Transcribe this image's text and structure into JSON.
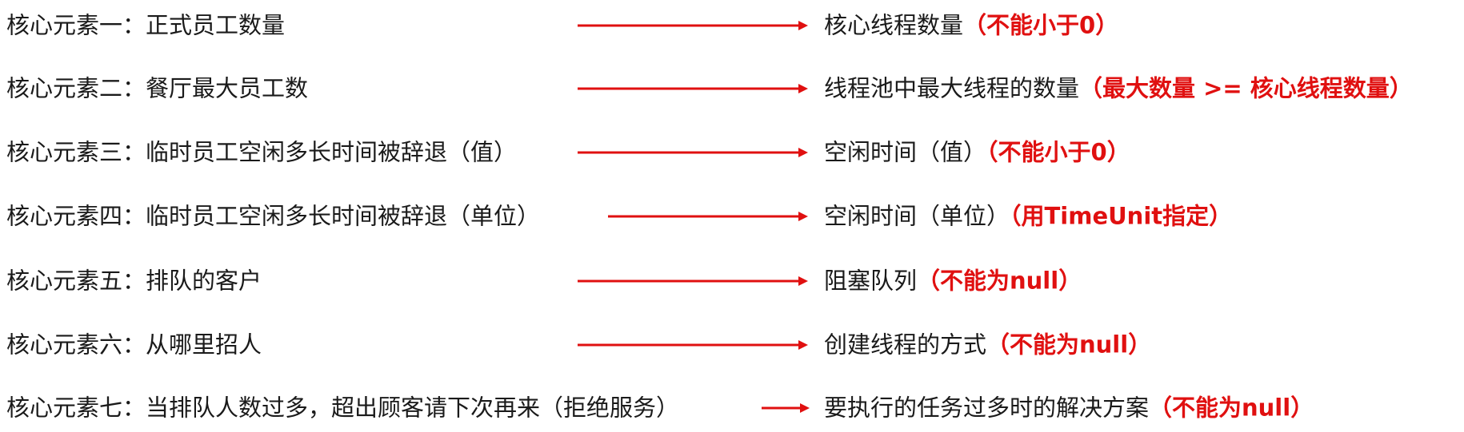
{
  "accent_color": "#e01010",
  "rows": [
    {
      "left": "核心元素一：正式员工数量",
      "right": "核心线程数量",
      "note": "（不能小于0）"
    },
    {
      "left": "核心元素二：餐厅最大员工数",
      "right": "线程池中最大线程的数量",
      "note": "（最大数量 >= 核心线程数量）"
    },
    {
      "left": "核心元素三：临时员工空闲多长时间被辞退（值）",
      "right": "空闲时间（值）",
      "note": "（不能小于0）"
    },
    {
      "left": "核心元素四：临时员工空闲多长时间被辞退（单位）",
      "right": "空闲时间（单位）",
      "note": "（用TimeUnit指定）"
    },
    {
      "left": "核心元素五：排队的客户",
      "right": "阻塞队列",
      "note": "（不能为null）"
    },
    {
      "left": "核心元素六：从哪里招人",
      "right": "创建线程的方式",
      "note": "（不能为null）"
    },
    {
      "left": "核心元素七：当排队人数过多，超出顾客请下次再来（拒绝服务）",
      "right": "要执行的任务过多时的解决方案",
      "note": "（不能为null）"
    }
  ]
}
